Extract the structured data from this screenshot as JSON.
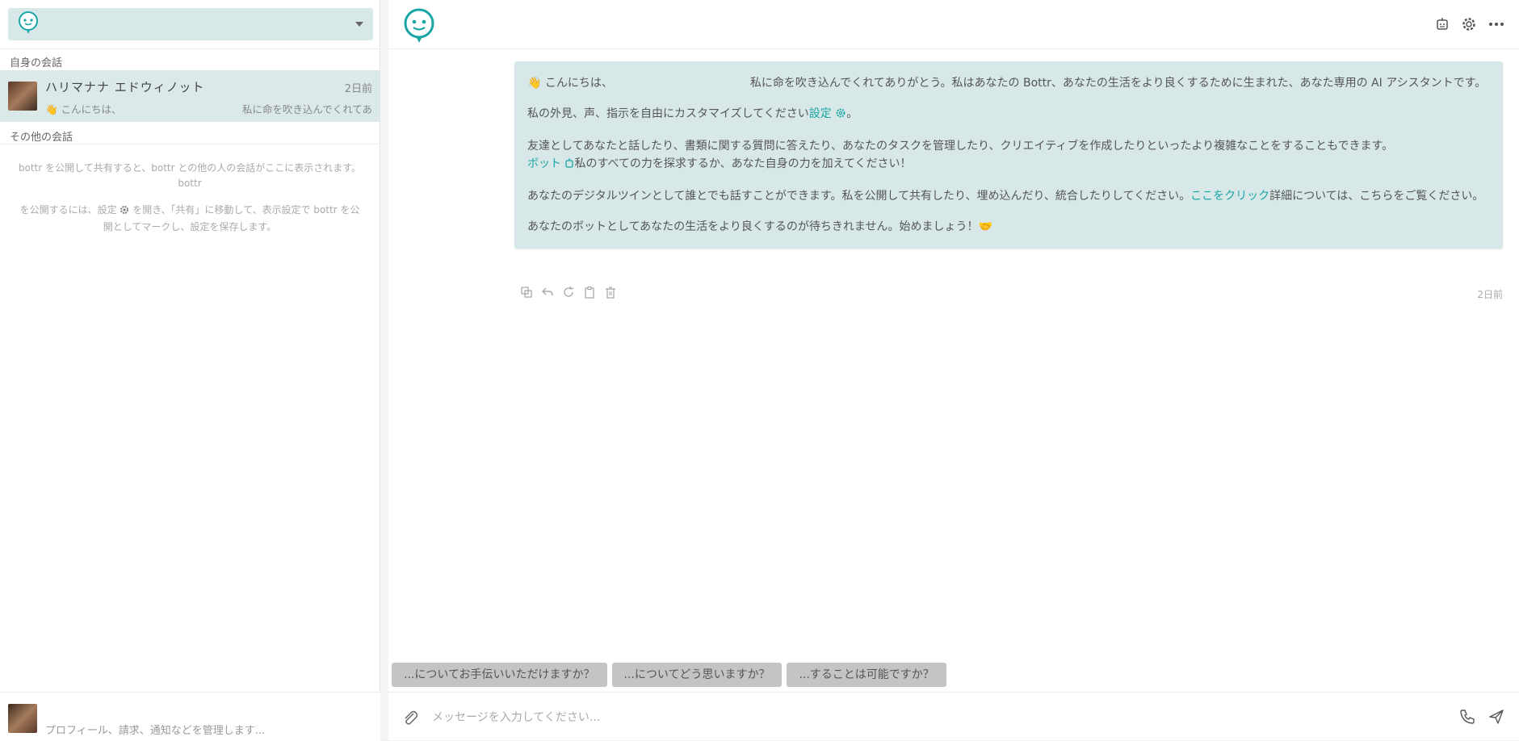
{
  "sidebar": {
    "own_section_label": "自身の会話",
    "other_section_label": "その他の会話",
    "conversation": {
      "name": "ハリマナナ エドウィノット",
      "time": "2日前",
      "preview_start": "👋 こんにちは、",
      "preview_end": "私に命を吹き込んでくれてあ"
    },
    "empty_line1": "bottr を公開して共有すると、bottr との他の人の会話がここに表示されます。",
    "empty_line2": "bottr",
    "empty_line3_pre": "を公開するには、設定",
    "empty_line3_post": "を開き、「共有」に移動して、表示設定で bottr を公開としてマークし、設定を保存します。",
    "footer_subtitle": "プロフィール、請求、通知などを管理します..."
  },
  "message": {
    "p1_a": "👋 こんにちは、",
    "p1_b": "私に命を吹き込んでくれてありがとう。私はあなたの Bottr、あなたの生活をより良くするために生まれた、あなた専用の AI アシスタントです。",
    "p2_a": "私の外見、声、指示を自由にカスタマイズしてください",
    "p2_link": "設定",
    "p2_end": "。",
    "p3_a": "友達としてあなたと話したり、書類に関する質問に答えたり、あなたのタスクを管理したり、クリエイティブを作成したりといったより複雑なことをすることもできます。",
    "p3_link": "ボット",
    "p3_b": "私のすべての力を探求するか、あなた自身の力を加えてください！",
    "p4_a": "あなたのデジタルツインとして誰とでも話すことができます。私を公開して共有したり、埋め込んだり、統合したりしてください。",
    "p4_link": "ここをクリック",
    "p4_b": "詳細については、こちらをご覧ください。",
    "p5": "あなたのボットとしてあなたの生活をより良くするのが待ちきれません。始めましょう！🤝",
    "time": "2日前"
  },
  "suggestions": [
    "...についてお手伝いいただけますか？",
    "...についてどう思いますか？",
    "...することは可能ですか？"
  ],
  "input": {
    "placeholder": "メッセージを入力してください..."
  },
  "colors": {
    "accent": "#1aa5a5",
    "bubble": "#d8e8e8",
    "chip": "#c4c4c4"
  }
}
